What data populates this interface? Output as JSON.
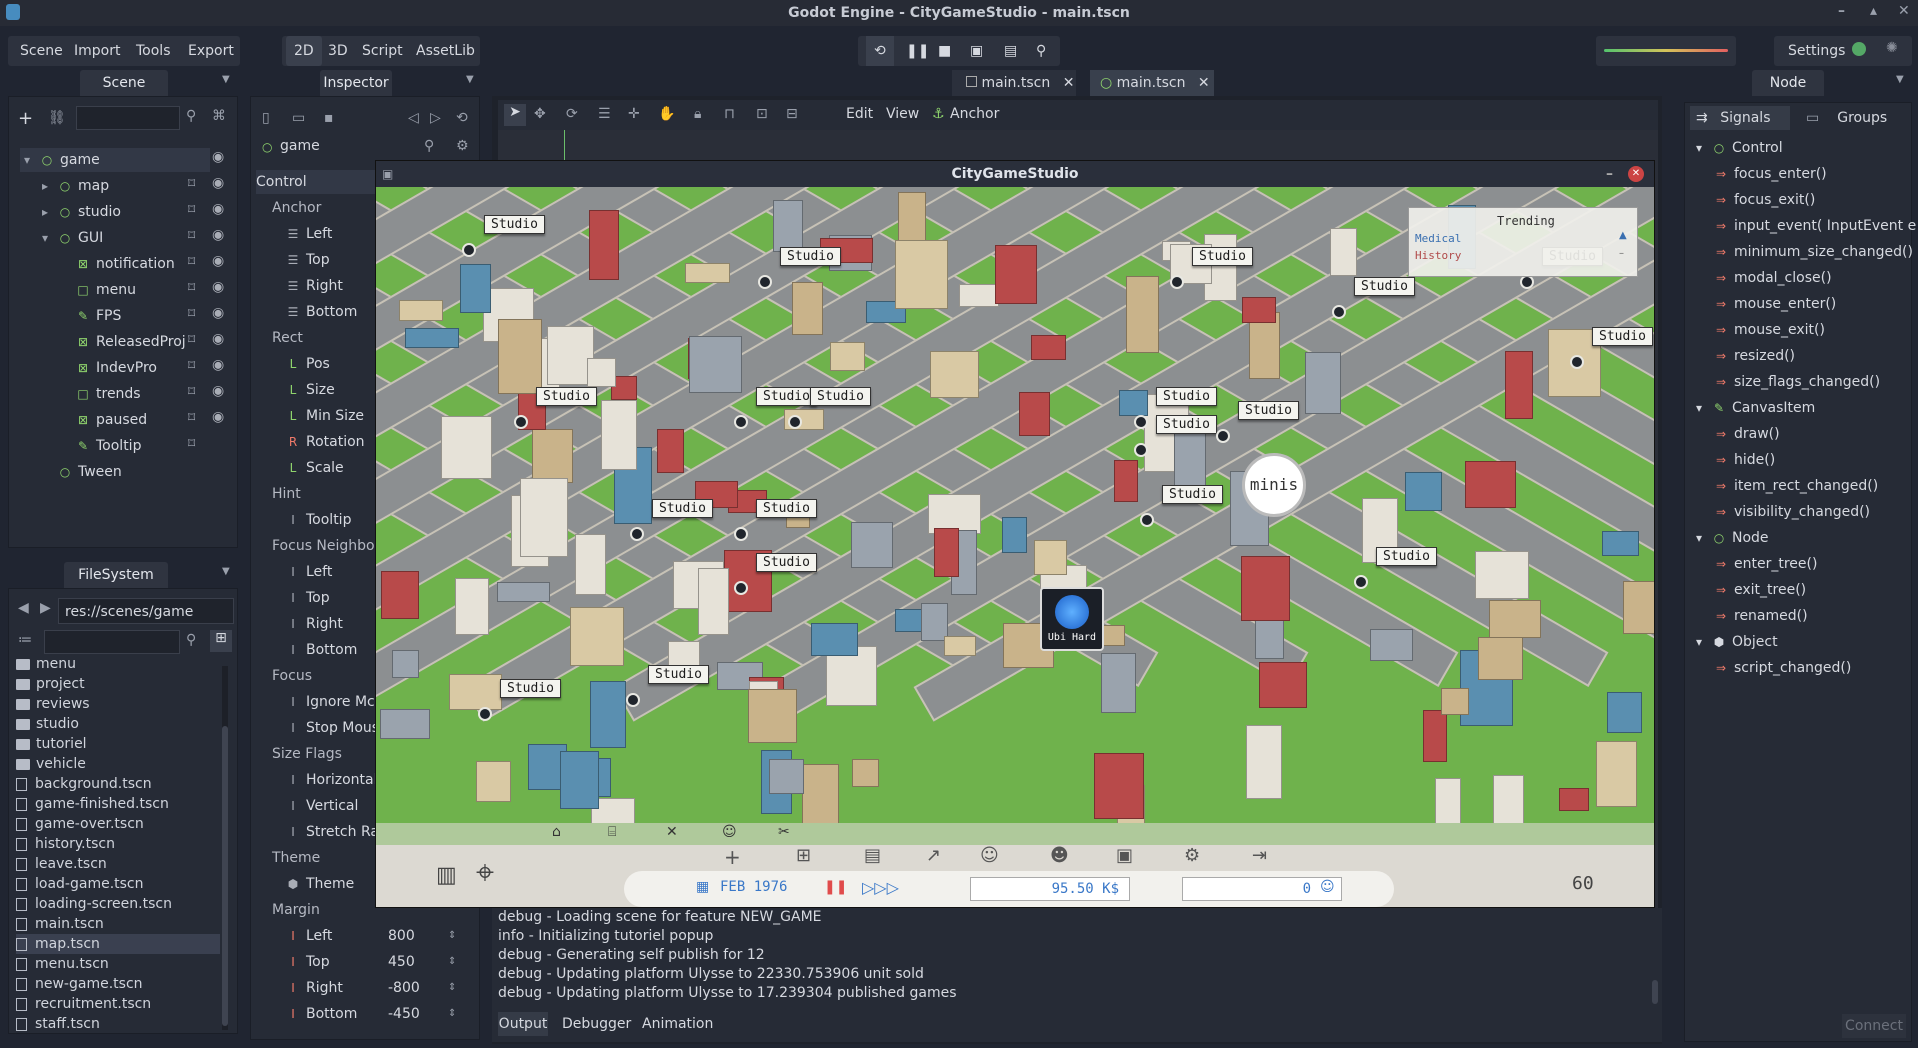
{
  "window": {
    "title": "Godot Engine - CityGameStudio - main.tscn"
  },
  "menu": {
    "items": [
      "Scene",
      "Import",
      "Tools",
      "Export"
    ],
    "modes": [
      "2D",
      "3D",
      "Script",
      "AssetLib"
    ],
    "settings": "Settings"
  },
  "docs": {
    "tabs": [
      "main.tscn",
      "main.tscn"
    ]
  },
  "scene_panel": {
    "title": "Scene",
    "tree": [
      {
        "label": "game",
        "depth": 0
      },
      {
        "label": "map",
        "depth": 1
      },
      {
        "label": "studio",
        "depth": 1
      },
      {
        "label": "GUI",
        "depth": 1
      },
      {
        "label": "notification",
        "depth": 2
      },
      {
        "label": "menu",
        "depth": 2
      },
      {
        "label": "FPS",
        "depth": 2
      },
      {
        "label": "ReleasedProj",
        "depth": 2
      },
      {
        "label": "IndevPro",
        "depth": 2
      },
      {
        "label": "trends",
        "depth": 2
      },
      {
        "label": "paused",
        "depth": 2
      },
      {
        "label": "Tooltip",
        "depth": 2
      },
      {
        "label": "Tween",
        "depth": 1
      }
    ]
  },
  "filesystem": {
    "title": "FileSystem",
    "path": "res://scenes/game",
    "files": [
      "menu",
      "project",
      "reviews",
      "studio",
      "tutoriel",
      "vehicle",
      "background.tscn",
      "game-finished.tscn",
      "game-over.tscn",
      "history.tscn",
      "leave.tscn",
      "load-game.tscn",
      "loading-screen.tscn",
      "main.tscn",
      "map.tscn",
      "menu.tscn",
      "new-game.tscn",
      "recruitment.tscn",
      "staff.tscn"
    ],
    "selected": "map.tscn"
  },
  "inspector": {
    "title": "Inspector",
    "node": "game",
    "rows": [
      {
        "label": "Control",
        "type": "cat"
      },
      {
        "label": "Anchor",
        "type": "sub"
      },
      {
        "label": "Left",
        "type": "p"
      },
      {
        "label": "Top",
        "type": "p"
      },
      {
        "label": "Right",
        "type": "p"
      },
      {
        "label": "Bottom",
        "type": "p"
      },
      {
        "label": "Rect",
        "type": "sub"
      },
      {
        "label": "Pos",
        "type": "p"
      },
      {
        "label": "Size",
        "type": "p"
      },
      {
        "label": "Min Size",
        "type": "p"
      },
      {
        "label": "Rotation",
        "type": "p"
      },
      {
        "label": "Scale",
        "type": "p"
      },
      {
        "label": "Hint",
        "type": "sub"
      },
      {
        "label": "Tooltip",
        "type": "p"
      },
      {
        "label": "Focus Neighbo",
        "type": "sub"
      },
      {
        "label": "Left",
        "type": "p"
      },
      {
        "label": "Top",
        "type": "p"
      },
      {
        "label": "Right",
        "type": "p"
      },
      {
        "label": "Bottom",
        "type": "p"
      },
      {
        "label": "Focus",
        "type": "sub"
      },
      {
        "label": "Ignore Mc",
        "type": "p"
      },
      {
        "label": "Stop Mous",
        "type": "p"
      },
      {
        "label": "Size Flags",
        "type": "sub"
      },
      {
        "label": "Horizontal",
        "type": "p"
      },
      {
        "label": "Vertical",
        "type": "p"
      },
      {
        "label": "Stretch Rat",
        "type": "p"
      },
      {
        "label": "Theme",
        "type": "sub"
      },
      {
        "label": "Theme",
        "type": "p"
      },
      {
        "label": "Margin",
        "type": "sub"
      }
    ],
    "margins": [
      {
        "label": "Left",
        "value": "800"
      },
      {
        "label": "Top",
        "value": "450"
      },
      {
        "label": "Right",
        "value": "-800"
      },
      {
        "label": "Bottom",
        "value": "-450"
      }
    ]
  },
  "viewport_toolbar": {
    "edit": "Edit",
    "view": "View",
    "anchor": "Anchor"
  },
  "game": {
    "title": "CityGameStudio",
    "studio_label": "Studio",
    "minis": "minis",
    "ubi": "Ubi Hard",
    "trending": {
      "title": "Trending",
      "items": [
        "Medical",
        "History"
      ]
    },
    "hud": {
      "date": "FEB 1976",
      "money": "95.50 K$",
      "fans": "0",
      "fps": "60"
    }
  },
  "node_panel": {
    "title": "Node",
    "tabs": [
      "Signals",
      "Groups"
    ],
    "signals": [
      {
        "label": "Control",
        "cat": true
      },
      {
        "label": "focus_enter()"
      },
      {
        "label": "focus_exit()"
      },
      {
        "label": "input_event( InputEvent e"
      },
      {
        "label": "minimum_size_changed()"
      },
      {
        "label": "modal_close()"
      },
      {
        "label": "mouse_enter()"
      },
      {
        "label": "mouse_exit()"
      },
      {
        "label": "resized()"
      },
      {
        "label": "size_flags_changed()"
      },
      {
        "label": "CanvasItem",
        "cat": true
      },
      {
        "label": "draw()"
      },
      {
        "label": "hide()"
      },
      {
        "label": "item_rect_changed()"
      },
      {
        "label": "visibility_changed()"
      },
      {
        "label": "Node",
        "cat": true
      },
      {
        "label": "enter_tree()"
      },
      {
        "label": "exit_tree()"
      },
      {
        "label": "renamed()"
      },
      {
        "label": "Object",
        "cat": true
      },
      {
        "label": "script_changed()"
      }
    ],
    "connect": "Connect"
  },
  "output": {
    "lines": [
      "debug - Loading scene for feature NEW_GAME",
      "info - Initializing tutoriel popup",
      "debug - Generating self publish for 12",
      "debug - Updating platform Ulysse to 22330.753906 unit sold",
      "debug - Updating platform Ulysse to 17.239304 published games"
    ],
    "tabs": [
      "Output",
      "Debugger",
      "Animation"
    ]
  }
}
